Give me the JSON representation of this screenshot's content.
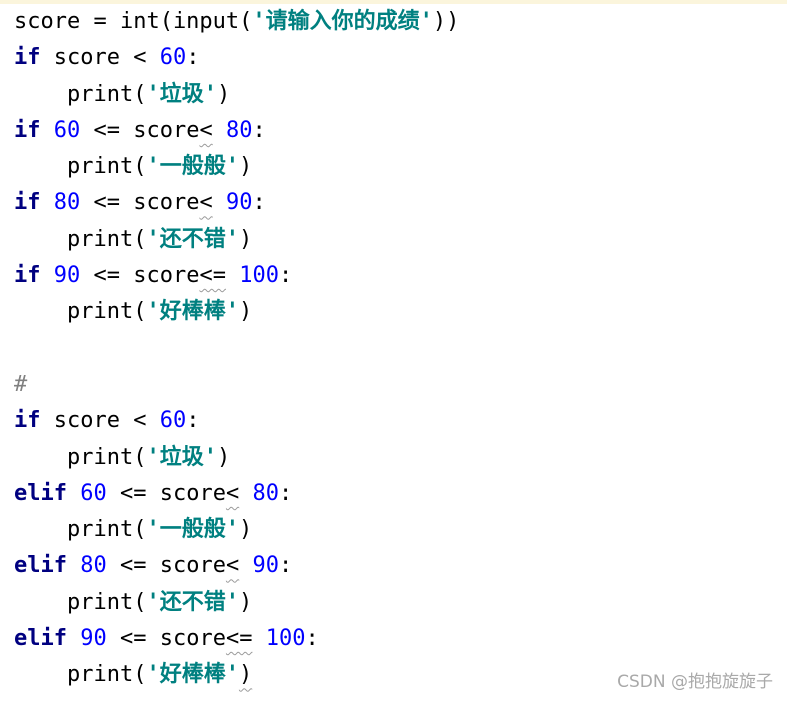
{
  "editor": {
    "lines": [
      [
        {
          "t": "score = int(input(",
          "c": "plain"
        },
        {
          "t": "'请输入你的成绩'",
          "c": "str"
        },
        {
          "t": "))",
          "c": "plain"
        }
      ],
      [
        {
          "t": "if",
          "c": "kw"
        },
        {
          "t": " score < ",
          "c": "plain"
        },
        {
          "t": "60",
          "c": "num"
        },
        {
          "t": ":",
          "c": "plain"
        }
      ],
      [
        {
          "t": "    print(",
          "c": "plain"
        },
        {
          "t": "'垃圾'",
          "c": "str"
        },
        {
          "t": ")",
          "c": "plain"
        }
      ],
      [
        {
          "t": "if",
          "c": "kw"
        },
        {
          "t": " ",
          "c": "plain"
        },
        {
          "t": "60",
          "c": "num"
        },
        {
          "t": " <= score",
          "c": "plain"
        },
        {
          "t": "<",
          "c": "squig"
        },
        {
          "t": " ",
          "c": "plain"
        },
        {
          "t": "80",
          "c": "num"
        },
        {
          "t": ":",
          "c": "plain"
        }
      ],
      [
        {
          "t": "    print(",
          "c": "plain"
        },
        {
          "t": "'一般般'",
          "c": "str"
        },
        {
          "t": ")",
          "c": "plain"
        }
      ],
      [
        {
          "t": "if",
          "c": "kw"
        },
        {
          "t": " ",
          "c": "plain"
        },
        {
          "t": "80",
          "c": "num"
        },
        {
          "t": " <= score",
          "c": "plain"
        },
        {
          "t": "<",
          "c": "squig"
        },
        {
          "t": " ",
          "c": "plain"
        },
        {
          "t": "90",
          "c": "num"
        },
        {
          "t": ":",
          "c": "plain"
        }
      ],
      [
        {
          "t": "    print(",
          "c": "plain"
        },
        {
          "t": "'还不错'",
          "c": "str"
        },
        {
          "t": ")",
          "c": "plain"
        }
      ],
      [
        {
          "t": "if",
          "c": "kw"
        },
        {
          "t": " ",
          "c": "plain"
        },
        {
          "t": "90",
          "c": "num"
        },
        {
          "t": " <= score",
          "c": "plain"
        },
        {
          "t": "<=",
          "c": "squig"
        },
        {
          "t": " ",
          "c": "plain"
        },
        {
          "t": "100",
          "c": "num"
        },
        {
          "t": ":",
          "c": "plain"
        }
      ],
      [
        {
          "t": "    print(",
          "c": "plain"
        },
        {
          "t": "'好棒棒'",
          "c": "str"
        },
        {
          "t": ")",
          "c": "plain"
        }
      ],
      [],
      [
        {
          "t": "#",
          "c": "cmt"
        }
      ],
      [
        {
          "t": "if",
          "c": "kw"
        },
        {
          "t": " score < ",
          "c": "plain"
        },
        {
          "t": "60",
          "c": "num"
        },
        {
          "t": ":",
          "c": "plain"
        }
      ],
      [
        {
          "t": "    print(",
          "c": "plain"
        },
        {
          "t": "'垃圾'",
          "c": "str"
        },
        {
          "t": ")",
          "c": "plain"
        }
      ],
      [
        {
          "t": "elif",
          "c": "kw"
        },
        {
          "t": " ",
          "c": "plain"
        },
        {
          "t": "60",
          "c": "num"
        },
        {
          "t": " <= score",
          "c": "plain"
        },
        {
          "t": "<",
          "c": "squig"
        },
        {
          "t": " ",
          "c": "plain"
        },
        {
          "t": "80",
          "c": "num"
        },
        {
          "t": ":",
          "c": "plain"
        }
      ],
      [
        {
          "t": "    print(",
          "c": "plain"
        },
        {
          "t": "'一般般'",
          "c": "str"
        },
        {
          "t": ")",
          "c": "plain"
        }
      ],
      [
        {
          "t": "elif",
          "c": "kw"
        },
        {
          "t": " ",
          "c": "plain"
        },
        {
          "t": "80",
          "c": "num"
        },
        {
          "t": " <= score",
          "c": "plain"
        },
        {
          "t": "<",
          "c": "squig"
        },
        {
          "t": " ",
          "c": "plain"
        },
        {
          "t": "90",
          "c": "num"
        },
        {
          "t": ":",
          "c": "plain"
        }
      ],
      [
        {
          "t": "    print(",
          "c": "plain"
        },
        {
          "t": "'还不错'",
          "c": "str"
        },
        {
          "t": ")",
          "c": "plain"
        }
      ],
      [
        {
          "t": "elif",
          "c": "kw"
        },
        {
          "t": " ",
          "c": "plain"
        },
        {
          "t": "90",
          "c": "num"
        },
        {
          "t": " <= score",
          "c": "plain"
        },
        {
          "t": "<=",
          "c": "squig"
        },
        {
          "t": " ",
          "c": "plain"
        },
        {
          "t": "100",
          "c": "num"
        },
        {
          "t": ":",
          "c": "plain"
        }
      ],
      [
        {
          "t": "    print(",
          "c": "plain"
        },
        {
          "t": "'好棒棒'",
          "c": "str"
        },
        {
          "t": ")",
          "c": "squig"
        }
      ]
    ]
  },
  "watermark": {
    "text": "CSDN @抱抱旋旋子"
  },
  "colors": {
    "keyword": "#000080",
    "number": "#0000ff",
    "string": "#008080",
    "comment": "#808080",
    "text": "#000000",
    "background": "#ffffff"
  }
}
